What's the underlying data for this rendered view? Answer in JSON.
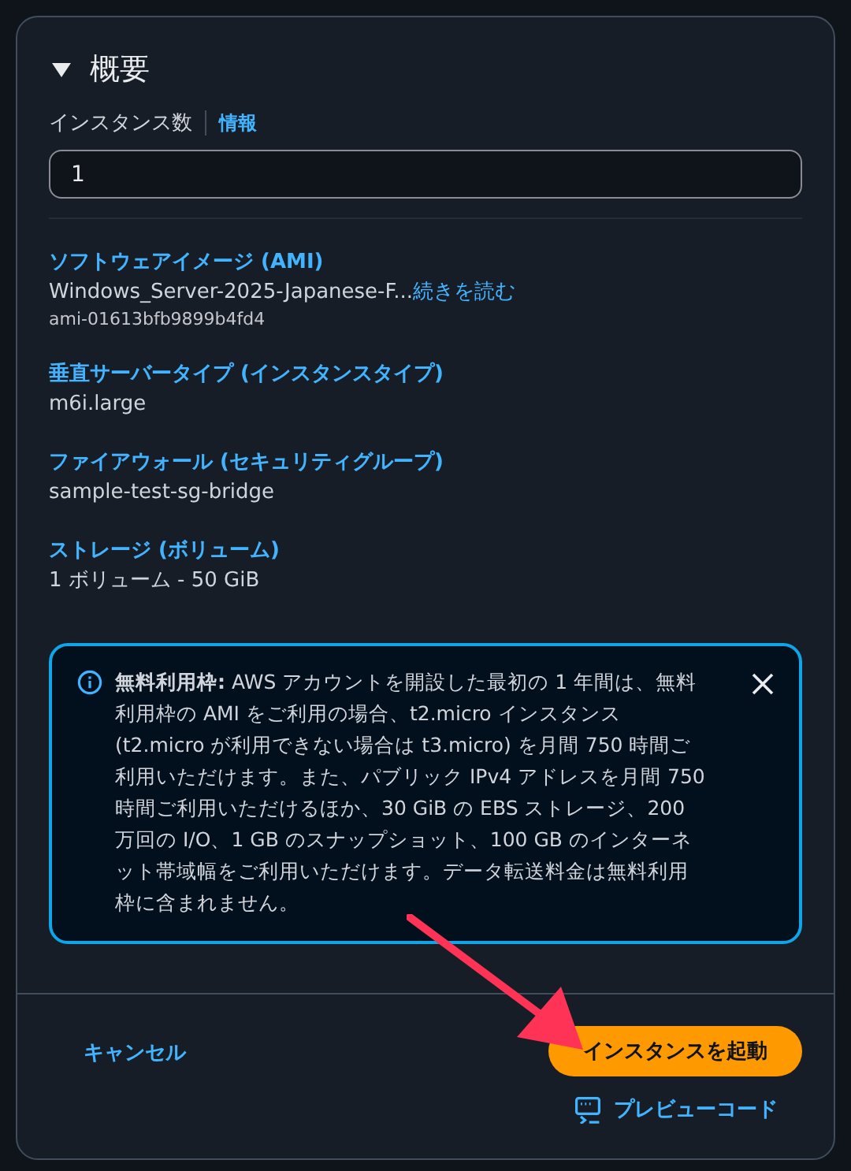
{
  "panel": {
    "title": "概要",
    "expanded": true
  },
  "instance_count": {
    "label": "インスタンス数",
    "info_link": "情報",
    "value": "1"
  },
  "sections": [
    {
      "label": "ソフトウェアイメージ (AMI)",
      "value": "Windows_Server-2025-Japanese-F...",
      "more_link": "続きを読む",
      "sub": "ami-01613bfb9899b4fd4"
    },
    {
      "label": "垂直サーバータイプ (インスタンスタイプ)",
      "value": "m6i.large"
    },
    {
      "label": "ファイアウォール (セキュリティグループ)",
      "value": "sample-test-sg-bridge"
    },
    {
      "label": "ストレージ (ボリューム)",
      "value": "1 ボリューム - 50 GiB"
    }
  ],
  "alert": {
    "text": "**無料利用枠:** AWS アカウントを開設した最初の 1 年間は、無料利用枠の AMI をご利用の場合、t2.micro インスタンス (t2.micro が利用できない場合は t3.micro) を月間 750 時間ご利用いただけます。また、パブリック IPv4 アドレスを月間 750 時間ご利用いただけるほか、30 GiB の EBS ストレージ、200 万回の I/O、1 GB のスナップショット、100 GB のインターネット帯域幅をご利用いただけます。データ転送料金は無料利用枠に含まれません。"
  },
  "footer": {
    "cancel": "キャンセル",
    "launch": "インスタンスを起動",
    "preview": "プレビューコード"
  }
}
